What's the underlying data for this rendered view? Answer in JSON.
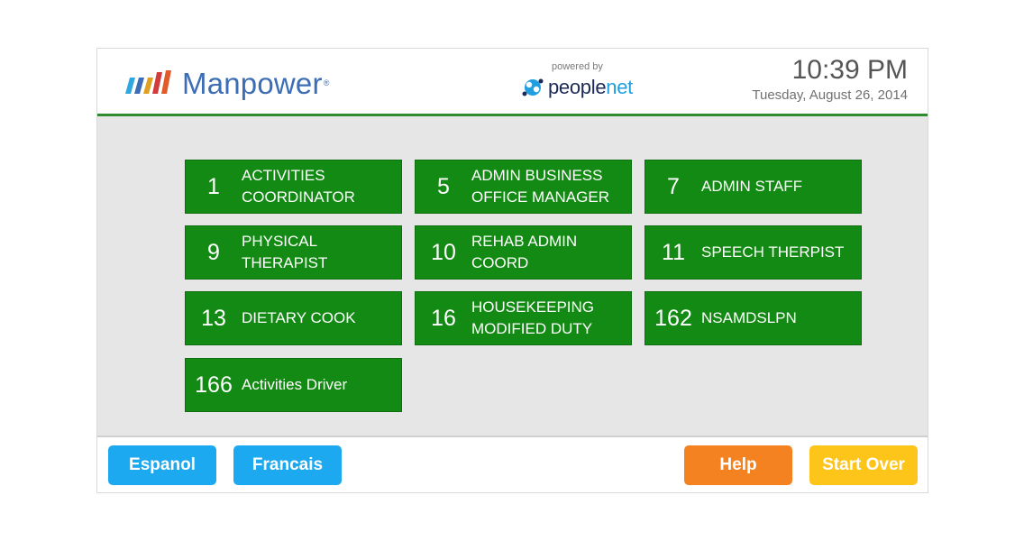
{
  "header": {
    "brand_name": "Manpower",
    "brand_reg": "®",
    "powered_by": "powered by",
    "partner_people": "people",
    "partner_net": "net",
    "time": "10:39 PM",
    "date": "Tuesday, August 26, 2014"
  },
  "jobs": [
    {
      "number": "1",
      "title": "ACTIVITIES\nCOORDINATOR"
    },
    {
      "number": "5",
      "title": "ADMIN BUSINESS\nOFFICE MANAGER"
    },
    {
      "number": "7",
      "title": "ADMIN STAFF"
    },
    {
      "number": "9",
      "title": "PHYSICAL THERAPIST"
    },
    {
      "number": "10",
      "title": "REHAB ADMIN\nCOORD"
    },
    {
      "number": "11",
      "title": "SPEECH THERPIST"
    },
    {
      "number": "13",
      "title": "DIETARY COOK"
    },
    {
      "number": "16",
      "title": "HOUSEKEEPING\nMODIFIED DUTY"
    },
    {
      "number": "162",
      "title": "NSAMDSLPN"
    },
    {
      "number": "166",
      "title": "Activities Driver"
    }
  ],
  "footer": {
    "espanol_label": "Espanol",
    "francais_label": "Francais",
    "help_label": "Help",
    "start_over_label": "Start Over"
  },
  "colors": {
    "header_line": "#2e8b2e",
    "job_button": "#138a13",
    "content_bg": "#e6e6e6",
    "language_button": "#1da9f0",
    "help_button": "#f58220",
    "start_over_button": "#fdc51a",
    "brand_blue": "#3d6db5"
  }
}
